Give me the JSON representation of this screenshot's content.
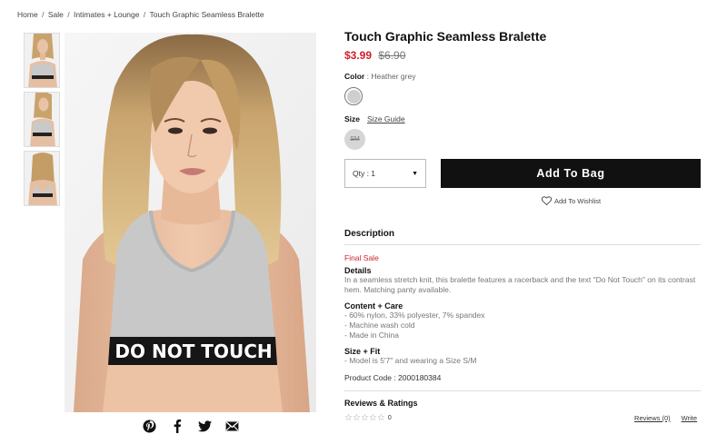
{
  "breadcrumb": {
    "items": [
      "Home",
      "Sale",
      "Intimates + Lounge",
      "Touch Graphic Seamless Bralette"
    ],
    "separator": "/"
  },
  "product": {
    "title": "Touch Graphic Seamless Bralette",
    "price_sale": "$3.99",
    "price_original": "$6.90",
    "color_label": "Color",
    "color_separator": ":",
    "color_value": "Heather grey",
    "size_label": "Size",
    "size_guide_label": "Size Guide",
    "size_option": "SM",
    "quantity_label": "Qty : 1",
    "add_to_bag_label": "Add To Bag",
    "wishlist_label": "Add To Wishlist",
    "image_print": "DO NOT TOUCH"
  },
  "description": {
    "heading": "Description",
    "final_sale": "Final Sale",
    "details_title": "Details",
    "details_text": "In a seamless stretch knit, this bralette features a racerback and the text \"Do Not Touch\" on its contrast hem. Matching panty available.",
    "content_title": "Content + Care",
    "content_lines": [
      "- 60% nylon, 33% polyester, 7% spandex",
      "- Machine wash cold",
      "- Made in China"
    ],
    "size_fit_title": "Size + Fit",
    "size_fit_lines": [
      "- Model is 5'7\" and wearing a Size S/M"
    ],
    "product_code": "Product Code : 2000180384"
  },
  "reviews": {
    "heading": "Reviews & Ratings",
    "star_count": "0",
    "reviews_link": "Reviews (0)",
    "write_link": "Write"
  },
  "share": [
    "pinterest-icon",
    "facebook-icon",
    "twitter-icon",
    "email-icon"
  ],
  "colors": {
    "sale_red": "#d1202a",
    "button_black": "#111111",
    "swatch_grey": "#cfcfcf"
  }
}
